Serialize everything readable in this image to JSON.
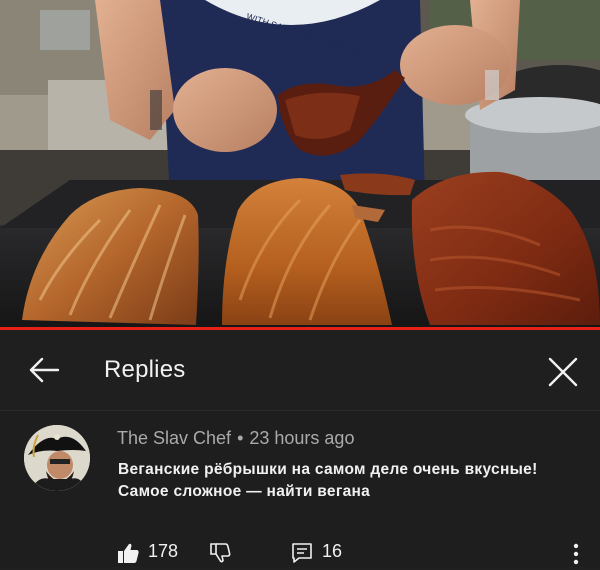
{
  "video": {
    "shirt_text": "WITH SAM CHOY & FRIENDS",
    "progress_fraction": 1.0
  },
  "header": {
    "title": "Replies",
    "back_icon": "arrow-left-icon",
    "close_icon": "close-icon"
  },
  "comment": {
    "author": "The Slav Chef",
    "separator": "•",
    "time": "23 hours ago",
    "text": "Веганские рёбрышки на самом деле очень вкусные! Самое сложное — найти вегана",
    "likes": "178",
    "replies": "16"
  },
  "colors": {
    "background": "#1f1f1f",
    "progress": "#e62117",
    "meta_text": "#aaaaaa"
  }
}
